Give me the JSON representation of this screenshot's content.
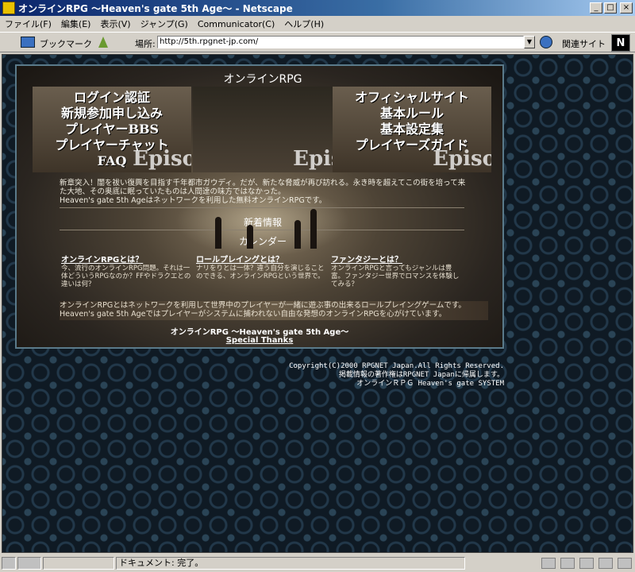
{
  "window": {
    "title": "オンラインRPG 〜Heaven's gate 5th Age〜 - Netscape",
    "buttons": {
      "minimize": "_",
      "maximize": "□",
      "close": "×"
    }
  },
  "menubar": [
    "ファイル(F)",
    "編集(E)",
    "表示(V)",
    "ジャンプ(G)",
    "Communicator(C)",
    "ヘルプ(H)"
  ],
  "toolbar": {
    "bookmarks_label": "ブックマーク",
    "location_label": "場所:",
    "url": "http://5th.rpgnet-jp.com/",
    "related_label": "関連サイト",
    "logo": "N"
  },
  "page": {
    "heading": "オンラインRPG",
    "left_links": [
      "ログイン認証",
      "新規参加申し込み",
      "プレイヤーBBS",
      "プレイヤーチャット",
      "FAQ"
    ],
    "right_links": [
      "オフィシャルサイト",
      "基本ルール",
      "基本設定集",
      "プレイヤーズガイド"
    ],
    "episode_text": "Episo",
    "intro_line1": "新章突入！闇を祓い復興を目指す千年都市ガウディ。だが、新たな脅威が再び訪れる。永き時を超えてこの街を培って来",
    "intro_line2": "た大地、その奥底に眠っていたものは人間達の味方ではなかった。",
    "intro_line3": "Heaven's gate 5th Ageはネットワークを利用した無料オンラインRPGです。",
    "news_label": "新着情報",
    "calendar_label": "カレンダー",
    "qa": [
      {
        "title": "オンラインRPGとは？",
        "text": "今、流行のオンラインRPG問題。それは一体どういうRPGなのか？FFやドラクエとの違いは何？"
      },
      {
        "title": "ロールプレイングとは？",
        "text": "ナリをりとは一体？違う自分を演じることのできる、オンラインRPGという世界で。"
      },
      {
        "title": "ファンタジーとは？",
        "text": "オンラインRPGと言ってもジャンルは豊富。ファンタジー世界でロマンスを体験してみる？"
      }
    ],
    "summary_line1": "オンラインRPGとはネットワークを利用して世界中のプレイヤーが一緒に遊ぶ事の出来るロールプレイングゲームです。",
    "summary_line2": "Heaven's gate 5th Ageではプレイヤーがシステムに捕われない自由な発想のオンラインRPGを心がけています。",
    "footer_title": "オンラインRPG 〜Heaven's gate 5th Age〜",
    "thanks": "Special Thanks",
    "copyright_line1": "Copyright(C)2000 RPGNET Japan.All Rights Reserved.",
    "copyright_line2": "掲載情報の著作権はRPGNET Japanに帰属します。",
    "copyright_line3": "オンラインＲＰＧ Heaven's gate SYSTEM"
  },
  "statusbar": {
    "text": "ドキュメント: 完了。"
  }
}
